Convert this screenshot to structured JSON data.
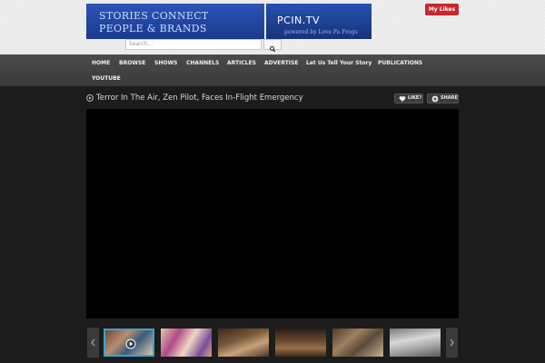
{
  "header": {
    "banner": {
      "line1": "STORIES CONNECT",
      "line2": "PEOPLE & BRANDS",
      "site": "PCIN.TV",
      "powered": "powered by Love Fa Frogs"
    },
    "search": {
      "placeholder": "Search..."
    },
    "my_likes_label": "My Likes"
  },
  "nav": {
    "row1": [
      "HOME",
      "BROWSE",
      "SHOWS",
      "CHANNELS",
      "ARTICLES",
      "ADVERTISE",
      "Let Us Tell Your Story",
      "PUBLICATIONS"
    ],
    "row2": [
      "YOUTUBE"
    ]
  },
  "video": {
    "title": "Terror In The Air, Zen Pilot, Faces In-Flight Emergency",
    "like_label": "LIKE?",
    "share_label": "SHARE"
  },
  "icons": {
    "search": "search-icon",
    "play": "play-circle-icon",
    "like": "heart-icon",
    "share": "plus-circle-icon",
    "prev": "chevron-left-icon",
    "next": "chevron-right-icon"
  },
  "colors": {
    "accent_red": "#c8272b",
    "banner_blue": "#1d3f9a",
    "active_thumb": "#38a6cc"
  }
}
